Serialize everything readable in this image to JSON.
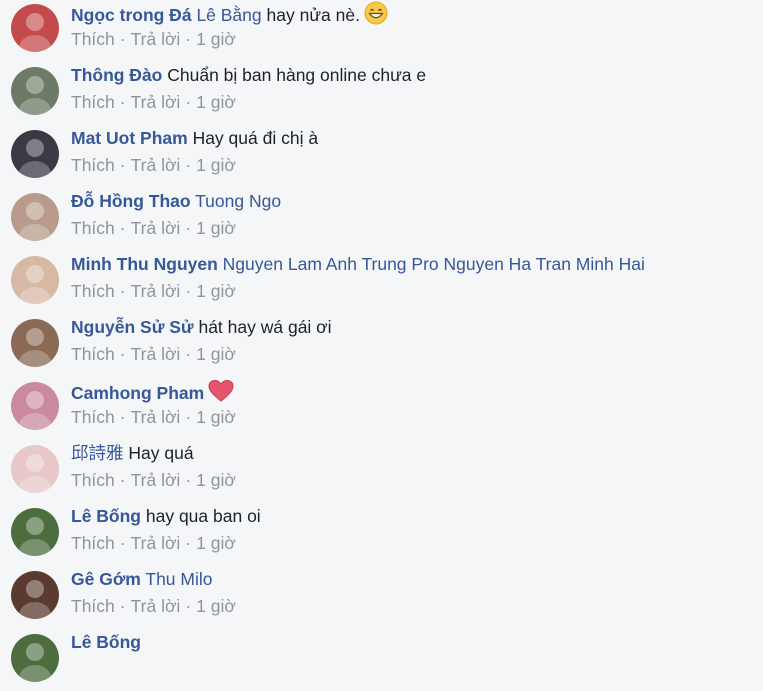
{
  "labels": {
    "like": "Thích",
    "reply": "Trả lời",
    "sep": "·"
  },
  "comments": [
    {
      "author": "Ngọc trong Đá",
      "tag": "Lê Bằng",
      "text": "hay nửa nè.",
      "emoji": "grinning-emoji",
      "time": "1 giờ",
      "avatar_color": "#c44b4b"
    },
    {
      "author": "Thông Đào",
      "tag": "",
      "text": "Chuẩn bị ban hàng online chưa e",
      "emoji": "",
      "time": "1 giờ",
      "avatar_color": "#6d7a66"
    },
    {
      "author": "Mat Uot Pham",
      "tag": "",
      "text": "Hay quá đi chị à",
      "emoji": "",
      "time": "1 giờ",
      "avatar_color": "#3a3a44"
    },
    {
      "author": "Đỗ Hồng Thao",
      "tag": "Tuong Ngo",
      "text": "",
      "emoji": "",
      "time": "1 giờ",
      "avatar_color": "#b89b8a"
    },
    {
      "author": "Minh Thu Nguyen",
      "tag": "Nguyen Lam Anh Trung Pro Nguyen Ha Tran Minh Hai",
      "text": "",
      "emoji": "",
      "time": "1 giờ",
      "avatar_color": "#d7b8a4"
    },
    {
      "author": "Nguyễn Sử Sử",
      "tag": "",
      "text": "hát hay wá gái ơi",
      "emoji": "",
      "time": "1 giờ",
      "avatar_color": "#8a6a55"
    },
    {
      "author": "Camhong Pham",
      "tag": "",
      "text": "",
      "emoji": "heart-emoji",
      "time": "1 giờ",
      "avatar_color": "#c98aa0"
    },
    {
      "author": "邱詩雅",
      "tag": "",
      "text": "Hay quá",
      "emoji": "",
      "time": "1 giờ",
      "avatar_color": "#e7c7c7"
    },
    {
      "author": "Lê Bống",
      "tag": "",
      "text": "hay qua ban oi",
      "emoji": "",
      "time": "1 giờ",
      "avatar_color": "#4e6d3f"
    },
    {
      "author": "Gê Gớm",
      "tag": "Thu Milo",
      "text": "",
      "emoji": "",
      "time": "1 giờ",
      "avatar_color": "#5b3b30"
    },
    {
      "author": "Lê Bống",
      "tag": "",
      "text": "",
      "emoji": "",
      "time": "",
      "avatar_color": "#4e6d3f"
    }
  ]
}
